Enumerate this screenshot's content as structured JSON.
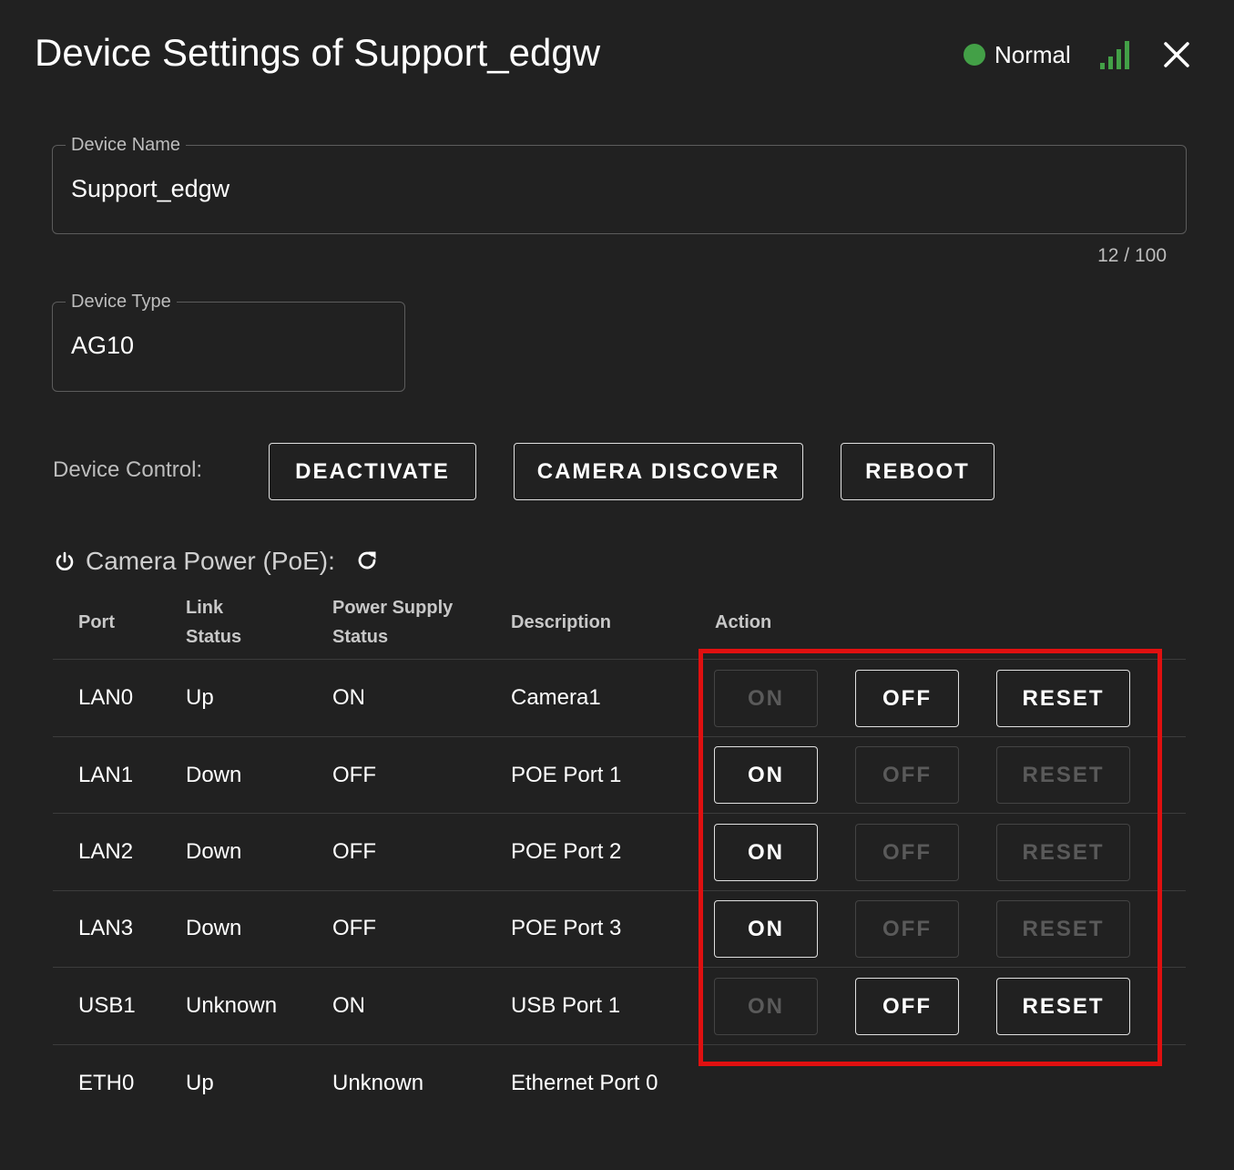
{
  "dialog": {
    "title": "Device Settings of Support_edgw",
    "status": {
      "label": "Normal",
      "color": "#43a047"
    },
    "signal_icon": "signal-bars-icon",
    "close_icon": "close-icon"
  },
  "device_name": {
    "label": "Device Name",
    "value": "Support_edgw",
    "counter": "12 / 100"
  },
  "device_type": {
    "label": "Device Type",
    "value": "AG10"
  },
  "device_control": {
    "label": "Device Control:",
    "buttons": {
      "deactivate": "DEACTIVATE",
      "camera_discover": "CAMERA DISCOVER",
      "reboot": "REBOOT"
    }
  },
  "poe": {
    "title": "Camera Power (PoE):",
    "icon": "power-icon",
    "refresh_icon": "refresh-icon",
    "columns": {
      "port": "Port",
      "link_status_1": "Link",
      "link_status_2": "Status",
      "power_supply_1": "Power Supply",
      "power_supply_2": "Status",
      "description": "Description",
      "action": "Action"
    },
    "action_labels": {
      "on": "ON",
      "off": "OFF",
      "reset": "RESET"
    },
    "rows": [
      {
        "port": "LAN0",
        "link": "Up",
        "power": "ON",
        "description": "Camera1"
      },
      {
        "port": "LAN1",
        "link": "Down",
        "power": "OFF",
        "description": "POE Port 1"
      },
      {
        "port": "LAN2",
        "link": "Down",
        "power": "OFF",
        "description": "POE Port 2"
      },
      {
        "port": "LAN3",
        "link": "Down",
        "power": "OFF",
        "description": "POE Port 3"
      },
      {
        "port": "USB1",
        "link": "Unknown",
        "power": "ON",
        "description": "USB Port 1"
      },
      {
        "port": "ETH0",
        "link": "Up",
        "power": "Unknown",
        "description": "Ethernet Port 0"
      }
    ]
  },
  "highlight_color": "#e01010"
}
